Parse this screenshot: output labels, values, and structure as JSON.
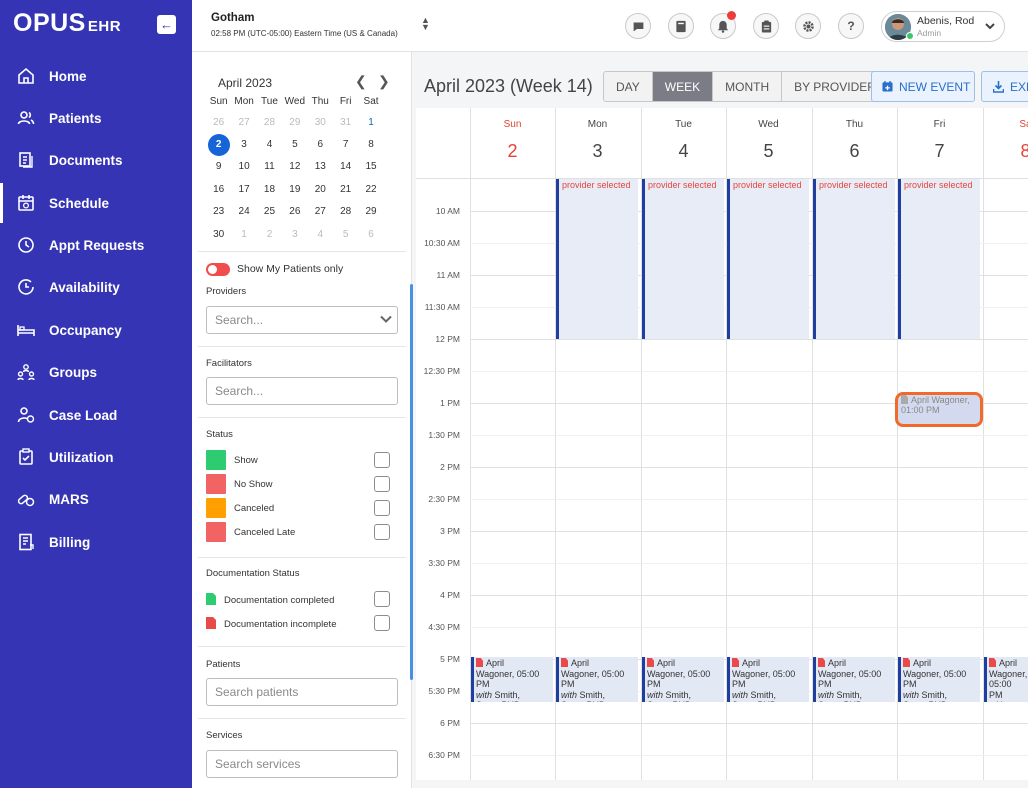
{
  "brand": {
    "name": "OPUS",
    "sub": "EHR"
  },
  "sidebar": {
    "items": [
      {
        "label": "Home",
        "icon": "home-icon"
      },
      {
        "label": "Patients",
        "icon": "people-icon"
      },
      {
        "label": "Documents",
        "icon": "documents-icon"
      },
      {
        "label": "Schedule",
        "icon": "calendar-icon",
        "active": true
      },
      {
        "label": "Appt Requests",
        "icon": "clock-icon"
      },
      {
        "label": "Availability",
        "icon": "availability-icon"
      },
      {
        "label": "Occupancy",
        "icon": "bed-icon"
      },
      {
        "label": "Groups",
        "icon": "groups-icon"
      },
      {
        "label": "Case Load",
        "icon": "case-load-icon"
      },
      {
        "label": "Utilization",
        "icon": "clipboard-check-icon"
      },
      {
        "label": "MARS",
        "icon": "pills-icon"
      },
      {
        "label": "Billing",
        "icon": "billing-icon"
      }
    ]
  },
  "topbar": {
    "location": "Gotham",
    "time": "02:58 PM (UTC-05:00) Eastern Time (US & Canada)",
    "user_name": "Abenis, Rod",
    "user_role": "Admin"
  },
  "mini_calendar": {
    "title": "April 2023",
    "weekdays": [
      "Sun",
      "Mon",
      "Tue",
      "Wed",
      "Thu",
      "Fri",
      "Sat"
    ],
    "weeks": [
      [
        "26",
        "27",
        "28",
        "29",
        "30",
        "31",
        "1"
      ],
      [
        "2",
        "3",
        "4",
        "5",
        "6",
        "7",
        "8"
      ],
      [
        "9",
        "10",
        "11",
        "12",
        "13",
        "14",
        "15"
      ],
      [
        "16",
        "17",
        "18",
        "19",
        "20",
        "21",
        "22"
      ],
      [
        "23",
        "24",
        "25",
        "26",
        "27",
        "28",
        "29"
      ],
      [
        "30",
        "1",
        "2",
        "3",
        "4",
        "5",
        "6"
      ]
    ],
    "selected_day": "2"
  },
  "filters": {
    "toggle_label": "Show My Patients only",
    "providers_label": "Providers",
    "providers_placeholder": "Search...",
    "facilitators_label": "Facilitators",
    "facilitators_placeholder": "Search...",
    "status_label": "Status",
    "statuses": [
      {
        "label": "Show",
        "color": "#2ecc71"
      },
      {
        "label": "No Show",
        "color": "#f26363"
      },
      {
        "label": "Canceled",
        "color": "#ffa000"
      },
      {
        "label": "Canceled Late",
        "color": "#f26363"
      }
    ],
    "doc_status_label": "Documentation Status",
    "doc_statuses": [
      {
        "label": "Documentation completed",
        "color": "#2ecc71"
      },
      {
        "label": "Documentation incomplete",
        "color": "#e84a4a"
      }
    ],
    "patients_label": "Patients",
    "patients_placeholder": "Search patients",
    "services_label": "Services",
    "services_placeholder": "Search services"
  },
  "calendar": {
    "title": "April 2023 (Week 14)",
    "views": [
      "DAY",
      "WEEK",
      "MONTH",
      "BY PROVIDER"
    ],
    "active_view": "WEEK",
    "new_event_label": "NEW EVENT",
    "export_label": "EXP",
    "days": [
      {
        "name": "Sun",
        "date": "2"
      },
      {
        "name": "Mon",
        "date": "3"
      },
      {
        "name": "Tue",
        "date": "4"
      },
      {
        "name": "Wed",
        "date": "5"
      },
      {
        "name": "Thu",
        "date": "6"
      },
      {
        "name": "Fri",
        "date": "7"
      },
      {
        "name": "Sa",
        "date": "8"
      }
    ],
    "time_labels": [
      "10 AM",
      "10:30 AM",
      "11 AM",
      "11:30 AM",
      "12 PM",
      "12:30 PM",
      "1 PM",
      "1:30 PM",
      "2 PM",
      "2:30 PM",
      "3 PM",
      "3:30 PM",
      "4 PM",
      "4:30 PM",
      "5 PM",
      "5:30 PM",
      "6 PM",
      "6:30 PM"
    ],
    "provider_block_text": "provider selected",
    "highlighted_event_text": "April Wagoner, 01:00 PM",
    "appointment": {
      "line1": "April",
      "line2": "Wagoner, 05:00",
      "line3": "PM",
      "with": "with",
      "line4": "Smith,",
      "line5": "Steve PHD"
    }
  }
}
